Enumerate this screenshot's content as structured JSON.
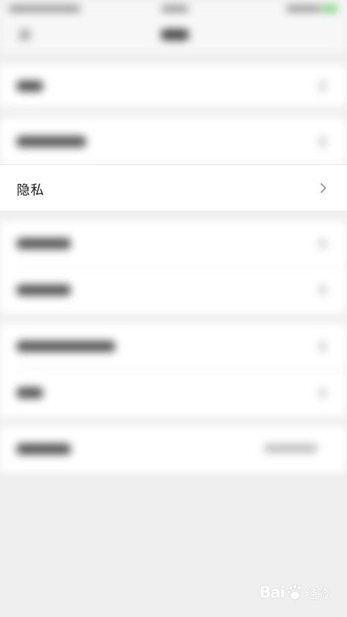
{
  "privacy_item": {
    "label": "隐私"
  },
  "watermark": {
    "text": "Bai",
    "cn": "经验"
  },
  "icons": {
    "chevron": "chevron-right-icon",
    "paw": "paw-icon"
  },
  "colors": {
    "background": "#efefef",
    "surface": "#ffffff",
    "chevron": "#9a9a9a"
  }
}
